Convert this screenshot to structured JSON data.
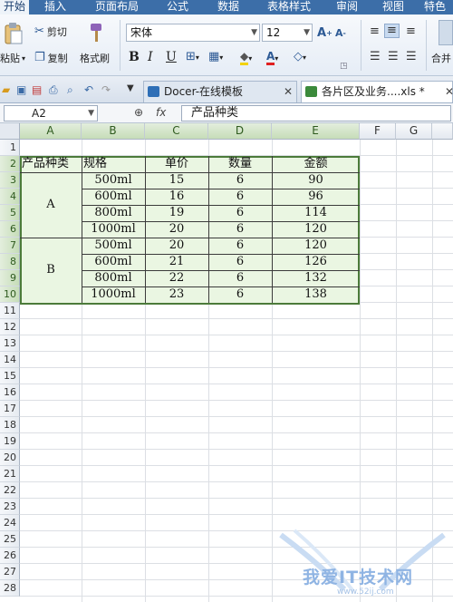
{
  "menu": [
    "开始",
    "插入",
    "页面布局",
    "公式",
    "数据",
    "表格样式",
    "审阅",
    "视图",
    "特色"
  ],
  "ribbon": {
    "paste": "粘贴",
    "cut": "剪切",
    "copy": "复制",
    "format_painter": "格式刷",
    "font": "宋体",
    "font_size": "12",
    "bold": "B",
    "italic": "I",
    "underline": "U",
    "merge": "合并"
  },
  "tabs": [
    {
      "label": "Docer-在线模板",
      "active": false
    },
    {
      "label": "各片区及业务....xls *",
      "active": true
    }
  ],
  "formula_bar": {
    "cell_ref": "A2",
    "fx": "fx",
    "content": "产品种类"
  },
  "columns": [
    "A",
    "B",
    "C",
    "D",
    "E",
    "F",
    "G"
  ],
  "rows": [
    "1",
    "2",
    "3",
    "4",
    "5",
    "6",
    "7",
    "8",
    "9",
    "10",
    "11",
    "12",
    "13",
    "14",
    "15",
    "16",
    "17",
    "18",
    "19",
    "20",
    "21",
    "22",
    "23",
    "24",
    "25",
    "26",
    "27",
    "28"
  ],
  "table": {
    "headers": [
      "产品种类",
      "规格",
      "单价",
      "数量",
      "金额"
    ],
    "groups": [
      "A",
      "B"
    ],
    "specs": [
      "500ml",
      "600ml",
      "800ml",
      "1000ml",
      "500ml",
      "600ml",
      "800ml",
      "1000ml"
    ],
    "prices": [
      "15",
      "16",
      "19",
      "20",
      "20",
      "21",
      "22",
      "23"
    ],
    "qty": [
      "6",
      "6",
      "6",
      "6",
      "6",
      "6",
      "6",
      "6"
    ],
    "amounts": [
      "90",
      "96",
      "114",
      "120",
      "120",
      "126",
      "132",
      "138"
    ]
  },
  "watermark": "我爱IT技术网",
  "watermark_url": "www.52ij.com"
}
